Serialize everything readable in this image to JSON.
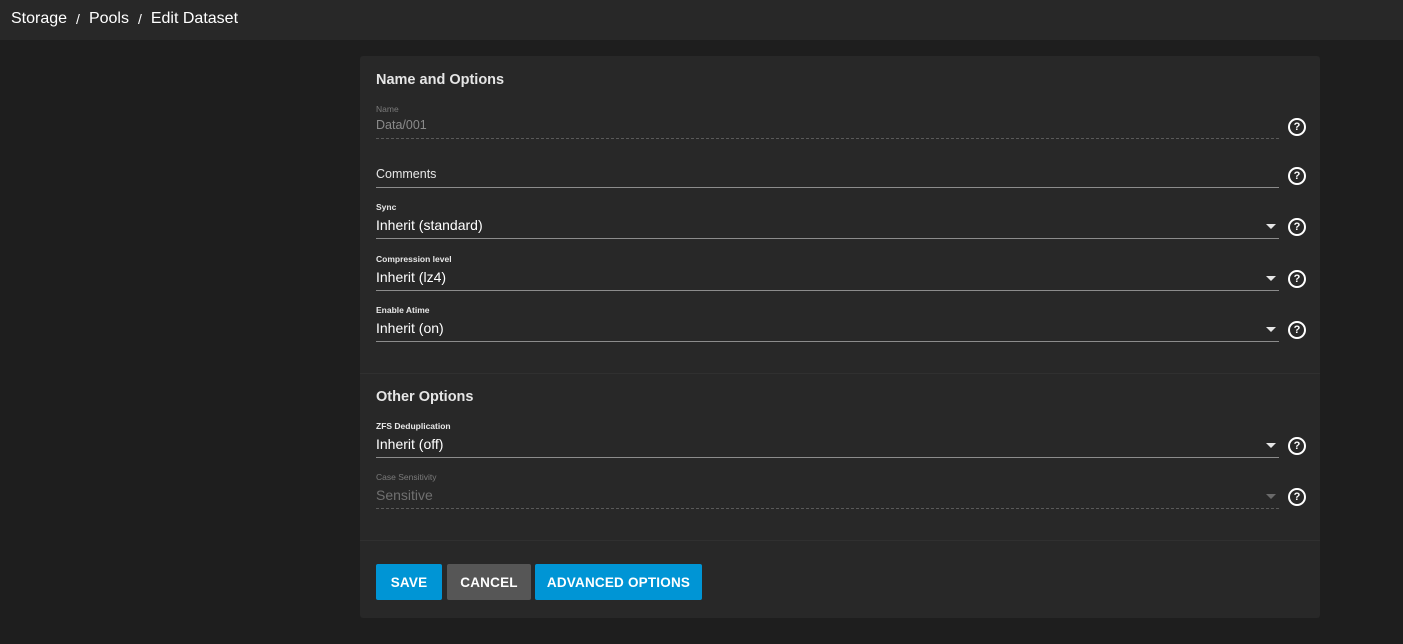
{
  "breadcrumb": {
    "items": [
      "Storage",
      "Pools",
      "Edit Dataset"
    ],
    "separator": "/"
  },
  "sections": {
    "name_options": {
      "title": "Name and Options"
    },
    "other_options": {
      "title": "Other Options"
    }
  },
  "fields": {
    "name": {
      "label": "Name",
      "value": "Data/001"
    },
    "comments": {
      "placeholder": "Comments",
      "value": ""
    },
    "sync": {
      "label": "Sync",
      "value": "Inherit (standard)"
    },
    "compression": {
      "label": "Compression level",
      "value": "Inherit (lz4)"
    },
    "atime": {
      "label": "Enable Atime",
      "value": "Inherit (on)"
    },
    "dedup": {
      "label": "ZFS Deduplication",
      "value": "Inherit (off)"
    },
    "case_sensitivity": {
      "label": "Case Sensitivity",
      "value": "Sensitive"
    }
  },
  "help_glyph": "?",
  "buttons": {
    "save": "SAVE",
    "cancel": "CANCEL",
    "advanced": "ADVANCED OPTIONS"
  },
  "colors": {
    "primary": "#0095d5",
    "secondary": "#565656",
    "card": "#282828",
    "background": "#1e1e1e"
  },
  "icons": {
    "help": "help-circle-icon",
    "dropdown": "caret-down-icon"
  }
}
